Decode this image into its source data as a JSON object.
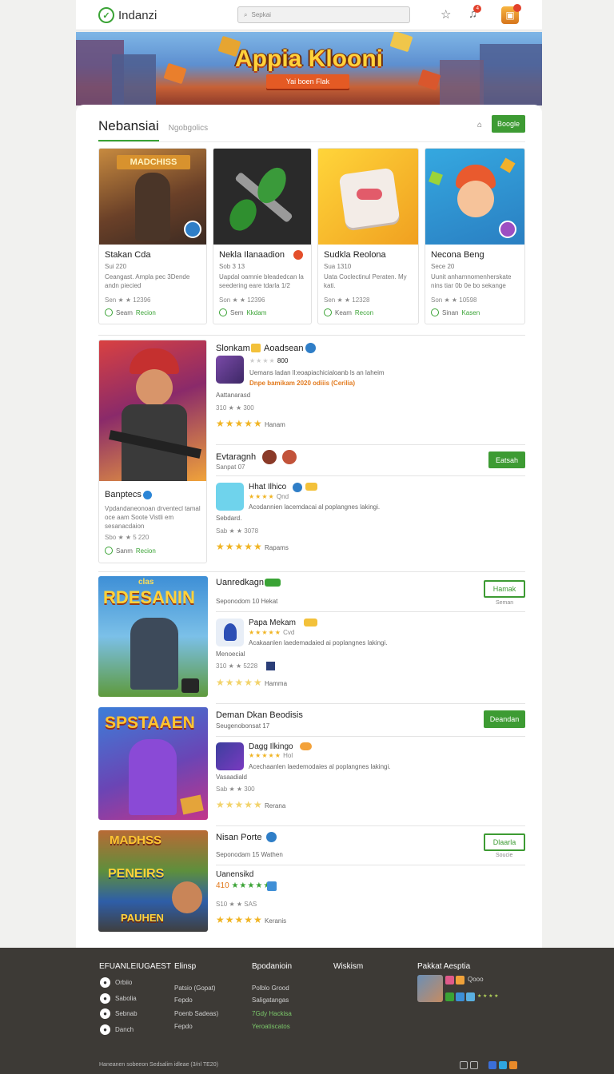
{
  "header": {
    "brand": "Indanzi",
    "search_placeholder": "Sepkai",
    "notification_count": "4"
  },
  "hero": {
    "title": "Appia Klooni",
    "ribbon": "Yai boen Flak"
  },
  "tabs": {
    "active": "Nebansiai",
    "other": "Ngobgolics"
  },
  "toolbar": {
    "google_button": "Boogle"
  },
  "cards": [
    {
      "art_title": "MADCHISS",
      "name": "Stakan Cda",
      "sub": "Sui 220",
      "desc": "Ceangast. Ampla pec 3Dende andn piecied",
      "meta": "Sen ★ ★ 12396",
      "install_label": "Seam",
      "install_action": "Recion"
    },
    {
      "name": "Nekla Ilanaadion",
      "sub": "Sob 3 13",
      "desc": "Uapdal oamnie bleadedcan la seedering eare tdarla 1/2",
      "meta": "Son ★ ★ 12396",
      "install_label": "Sem",
      "install_action": "Kkdam"
    },
    {
      "name": "Sudkla Reolona",
      "sub": "Sua 1310",
      "desc": "Uata Coclectinul Peraten. My kati.",
      "meta": "Sen ★ ★ 12328",
      "install_label": "Keam",
      "install_action": "Recon"
    },
    {
      "name": "Necona Beng",
      "sub": "Sece 20",
      "desc": "Uunit anhamnomenherskate nins tiar 0b 0e bo sekange",
      "meta": "Son ★ ★ 10598",
      "install_label": "Sinan",
      "install_action": "Kasen"
    }
  ],
  "feature_card": {
    "name": "Banptecs",
    "desc": "Vpdandaneonoan drventecl tamal oce aam Soote Vistli em sesanacdaion",
    "meta": "Sbo ★ ★ 5 220",
    "install_label": "Sanm",
    "install_action": "Recion"
  },
  "list1": {
    "title": "Slonkam",
    "badge": "Aoadsean",
    "rating_count": "800",
    "icon_desc": "Uemans ladan ll:eoapiachicialoanb ls an laheim",
    "promo": "Dnpe bamikam 2020 odiiis (Cerilia)",
    "author": "Aattanarasd",
    "reviews": "310 ★ ★ 300",
    "rating_label": "Hanam"
  },
  "list2": {
    "title": "Evtaragnh",
    "subtitle": "Sanpat 07",
    "button": "Eatsah",
    "app_name": "Hhat Ilhico",
    "app_rating": "Qnd",
    "desc": "Acodannien lacemdacai al poplangnes lakingi.",
    "desc2": "Sebdard.",
    "reviews": "Sab ★ ★ 3078",
    "rating_label": "Rapams"
  },
  "list3": {
    "title": "Uanredkagn",
    "subtitle": "Seponodom  10  Hekat",
    "button": "Hamak",
    "button_sub": "Seman",
    "app_name": "Papa Mekam",
    "app_rating": "Cvd",
    "desc": "Acakaanlen laedemadaied ai poplangnes lakingi.",
    "desc2": "Menoecial",
    "reviews": "310 ★ ★ 5228",
    "rating_label": "Hamma",
    "art_title": "RDESANIN",
    "art_sub": "clas"
  },
  "list4": {
    "title": "Deman Dkan Beodisis",
    "subtitle": "Seugenobonsat 17",
    "button": "Deandan",
    "app_name": "Dagg Ilkingo",
    "app_rating": "Hol",
    "desc": "Acechaanlen laedemodaies al poplangnes lakingi.",
    "desc2": "Vasaadiald",
    "reviews": "Sab ★ ★ 300",
    "rating_label": "Rerana",
    "art_title": "SPSTAAEN"
  },
  "list5": {
    "title": "Nisan Porte",
    "subtitle": "Seponodam  15  Wathen",
    "button": "Dlaarla",
    "button_sub": "Soucie",
    "app_name": "Uanensikd",
    "app_rating": "410",
    "reviews": "S10 ★ ★ SAS",
    "rating_label": "Keranis",
    "art_top": "MADHSS",
    "art_mid": "PENEIRS",
    "art_bottom": "PAUHEN"
  },
  "footer": {
    "col1": {
      "title": "EFUANLEIUGAEST",
      "links": [
        "Orbiio",
        "Sabolia",
        "Sebnab",
        "Danch"
      ]
    },
    "col2": {
      "title": "Elinsp",
      "links": [
        "Patsio (Gopat)",
        "Fepdo",
        "Poenb Sadeas)",
        "Fepdo"
      ]
    },
    "col3": {
      "title": "Bpodanioin",
      "links": [
        "Polblo Grood",
        "Saligatangas",
        "7Gdy Hackisa",
        "Yeroatiscatos"
      ]
    },
    "col4": {
      "title": "Wiskism"
    },
    "col5": {
      "title": "Pakkat Aesptia",
      "ratings": "Qooo",
      "stars": "★ ★ ★ ★"
    },
    "copyright": "Haneanen sobeeon Sedsalim idleae (3/nl TE20)"
  }
}
